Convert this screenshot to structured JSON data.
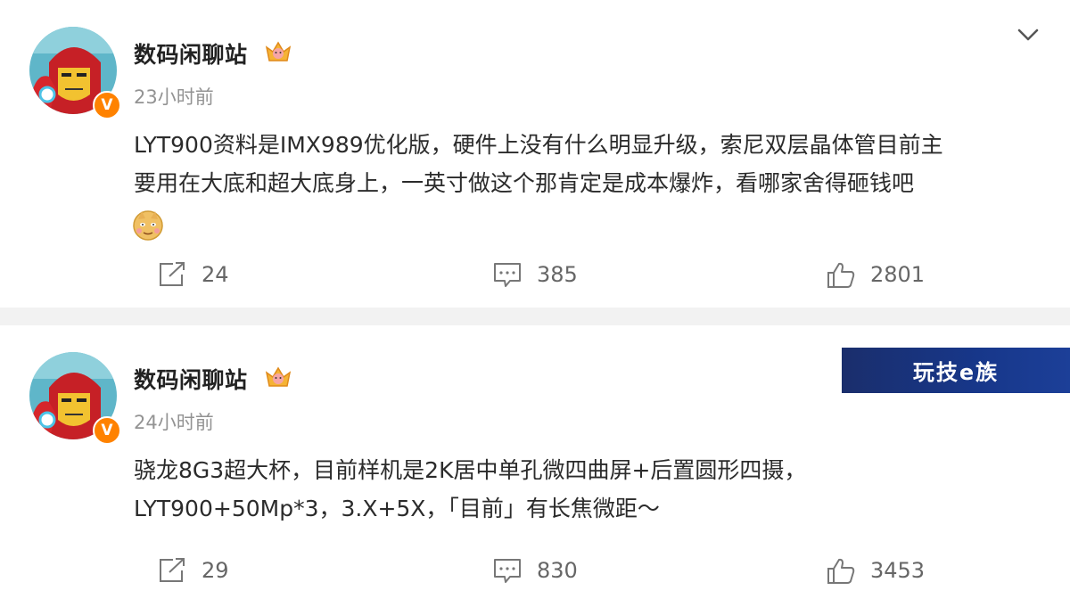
{
  "posts": [
    {
      "username": "数码闲聊站",
      "timestamp": "23小时前",
      "content_lines": [
        "LYT900资料是IMX989优化版，硬件上没有什么明显升级，索尼双层晶体管目前主",
        "要用在大底和超大底身上，一英寸做这个那肯定是成本爆炸，看哪家舍得砸钱吧"
      ],
      "emoji": "doge-emoji",
      "repost_count": "24",
      "comment_count": "385",
      "like_count": "2801",
      "verified_badge": "V"
    },
    {
      "username": "数码闲聊站",
      "timestamp": "24小时前",
      "content_lines": [
        "骁龙8G3超大杯，目前样机是2K居中单孔微四曲屏+后置圆形四摄，",
        "LYT900+50Mp*3，3.X+5X，「目前」有长焦微距～"
      ],
      "repost_count": "29",
      "comment_count": "830",
      "like_count": "3453",
      "verified_badge": "V"
    }
  ],
  "watermark": {
    "text": "玩技e族"
  },
  "icons": {
    "repost": "repost-icon",
    "comment": "comment-icon",
    "like": "like-icon",
    "expand": "chevron-down-icon",
    "crown": "crown-icon"
  },
  "colors": {
    "verified": "#ff8200",
    "timestamp": "#939393",
    "watermark_bg": "#17378a"
  }
}
